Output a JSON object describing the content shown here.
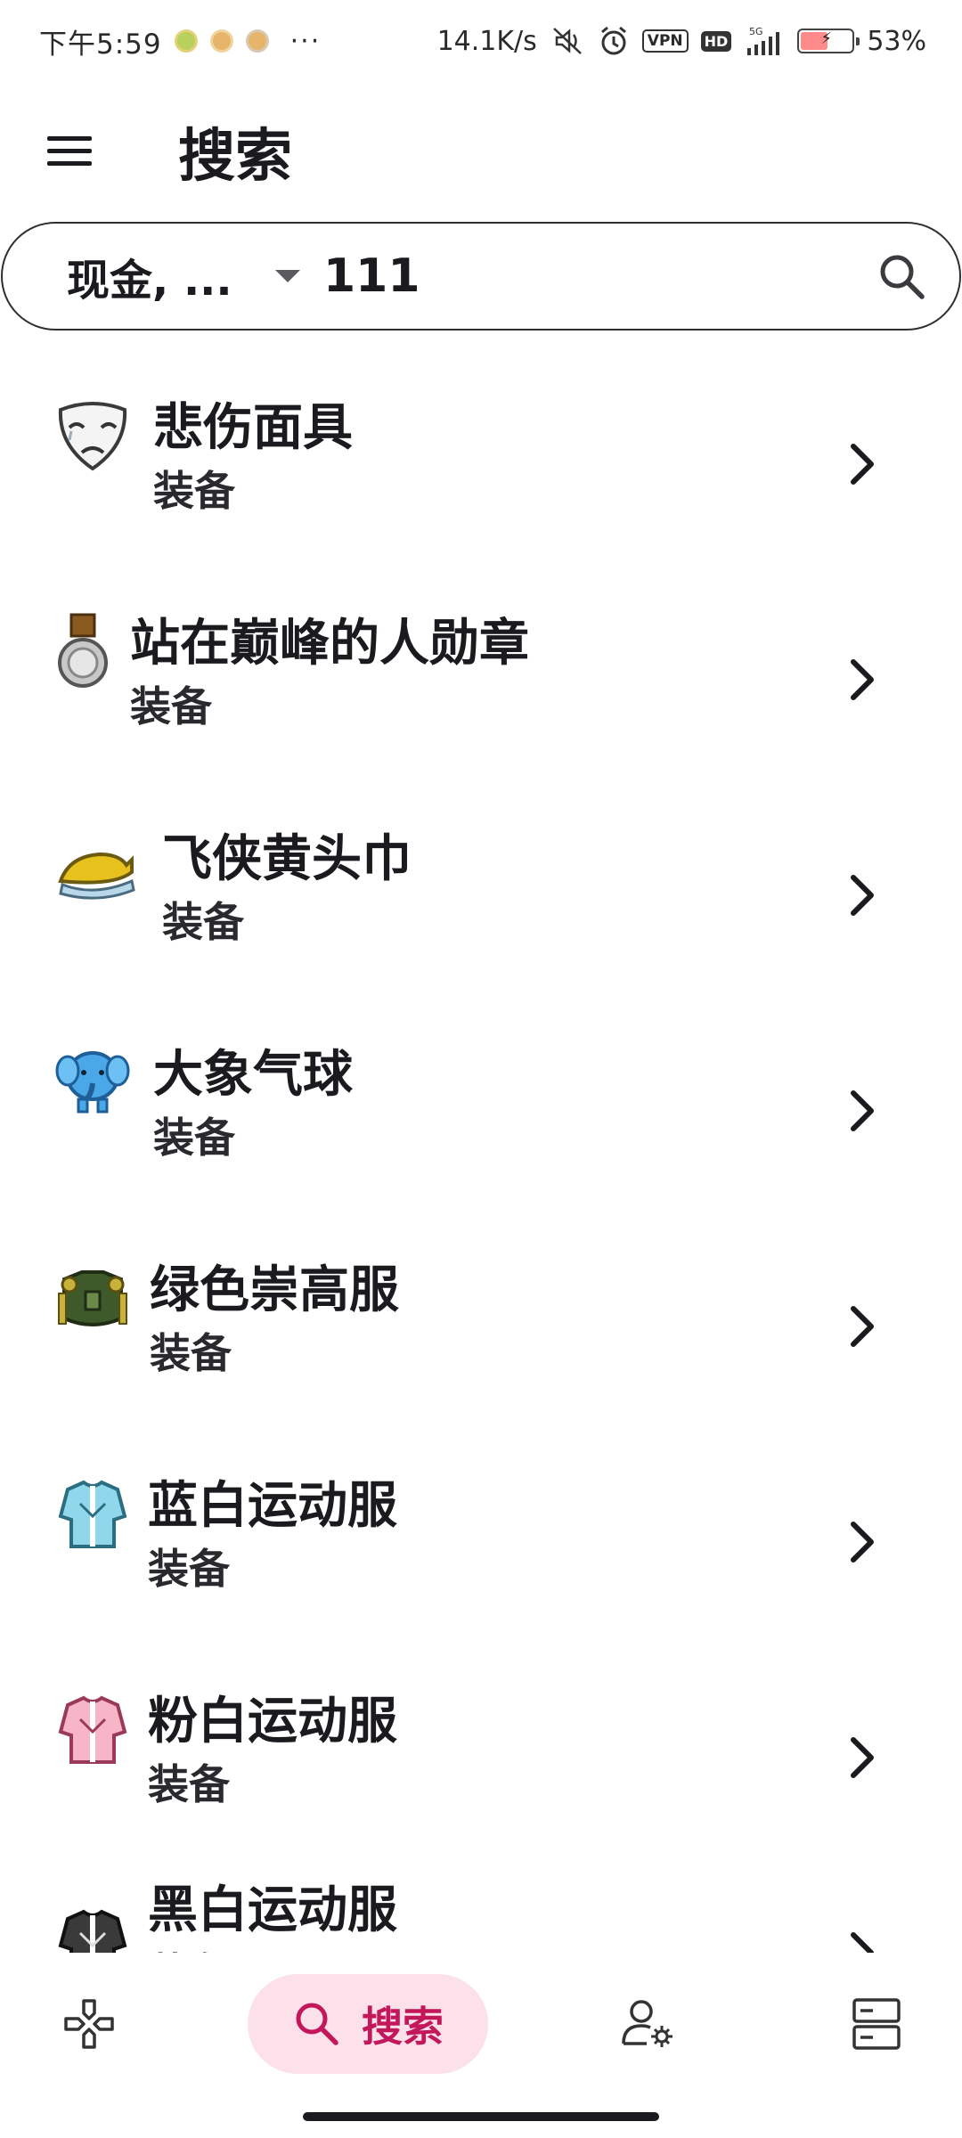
{
  "status_bar": {
    "time": "下午5:59",
    "more": "···",
    "net_speed": "14.1K/s",
    "vpn": "VPN",
    "hd": "HD",
    "network": "5G",
    "battery_level": 0.53,
    "battery_text": "53%"
  },
  "app_bar": {
    "title": "搜索",
    "menu_icon": "menu-icon"
  },
  "search": {
    "filter_label": "现金, ...",
    "query": "111",
    "search_icon": "search-icon"
  },
  "results": [
    {
      "name": "悲伤面具",
      "type": "装备",
      "icon": "sad-mask-icon"
    },
    {
      "name": "站在巅峰的人勋章",
      "type": "装备",
      "icon": "silver-medal-icon"
    },
    {
      "name": "飞侠黄头巾",
      "type": "装备",
      "icon": "yellow-bandana-icon"
    },
    {
      "name": "大象气球",
      "type": "装备",
      "icon": "elephant-balloon-icon"
    },
    {
      "name": "绿色崇高服",
      "type": "装备",
      "icon": "green-armor-icon"
    },
    {
      "name": "蓝白运动服",
      "type": "装备",
      "icon": "blue-tracksuit-icon"
    },
    {
      "name": "粉白运动服",
      "type": "装备",
      "icon": "pink-tracksuit-icon"
    },
    {
      "name": "黑白运动服",
      "type": "装备",
      "icon": "black-tracksuit-icon"
    }
  ],
  "bottom_nav": {
    "items": [
      {
        "icon": "gamepad-icon",
        "label": ""
      },
      {
        "icon": "search-icon",
        "label": "搜索",
        "active": true
      },
      {
        "icon": "user-settings-icon",
        "label": ""
      },
      {
        "icon": "server-icon",
        "label": ""
      }
    ]
  },
  "colors": {
    "accent": "#c2185b",
    "accent_container": "#fce1ea",
    "text": "#1b1b1f"
  }
}
